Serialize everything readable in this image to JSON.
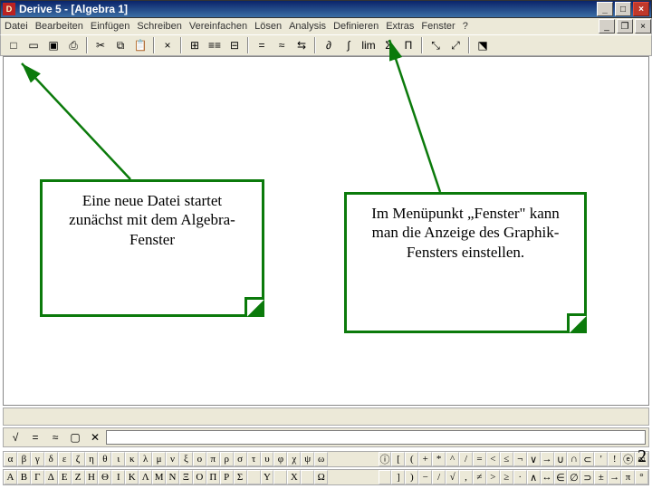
{
  "title": "Derive 5 - [Algebra 1]",
  "app_icon": "D",
  "window_buttons": {
    "min": "_",
    "max": "□",
    "close": "×"
  },
  "menu": [
    "Datei",
    "Bearbeiten",
    "Einfügen",
    "Schreiben",
    "Vereinfachen",
    "Lösen",
    "Analysis",
    "Definieren",
    "Extras",
    "Fenster",
    "?"
  ],
  "toolbar": [
    "□",
    "▭",
    "▣",
    "⎙",
    "|",
    "✂",
    "⧉",
    "📋",
    "|",
    "×",
    "|",
    "⊞",
    "≡≡",
    "⊟",
    "|",
    "=",
    "≈",
    "⇆",
    "|",
    "∂",
    "∫",
    "lim",
    "Σ",
    "Π",
    "|",
    "⤡",
    "⤢",
    "|",
    "⬔"
  ],
  "callout1": "Eine neue Datei startet zunächst mit dem Algebra-Fenster",
  "callout2": "Im Menüpunkt „Fenster\" kann man die Anzeige des Graphik-Fensters einstellen.",
  "input_tools": [
    "√",
    "=",
    "≈",
    "▢",
    "✕"
  ],
  "sym_row1_left": [
    "α",
    "β",
    "γ",
    "δ",
    "ε",
    "ζ",
    "η",
    "θ",
    "ι",
    "κ",
    "λ",
    "μ",
    "ν",
    "ξ",
    "ο",
    "π",
    "ρ",
    "σ",
    "τ",
    "υ",
    "φ",
    "χ",
    "ψ",
    "ω"
  ],
  "sym_row1_right": [
    "ⓘ",
    "[",
    "(",
    "+",
    "*",
    "^",
    "/",
    "=",
    "<",
    "≤",
    "¬",
    "∨",
    "→",
    "∪",
    "∩",
    "⊂",
    "'",
    "!",
    "ⓔ",
    "∞"
  ],
  "sym_row2_left": [
    "Α",
    "Β",
    "Γ",
    "Δ",
    "Ε",
    "Ζ",
    "Η",
    "Θ",
    "Ι",
    "Κ",
    "Λ",
    "Μ",
    "Ν",
    "Ξ",
    "Ο",
    "Π",
    "Ρ",
    "Σ",
    " ",
    "Υ",
    " ",
    "Χ",
    " ",
    "Ω"
  ],
  "sym_row2_right": [
    " ",
    "]",
    ")",
    "−",
    "/",
    "√",
    ",",
    "≠",
    ">",
    "≥",
    "·",
    "∧",
    "↔",
    "∈",
    "∅",
    "⊃",
    "±",
    "→",
    "π",
    "°"
  ],
  "page_number": "2"
}
